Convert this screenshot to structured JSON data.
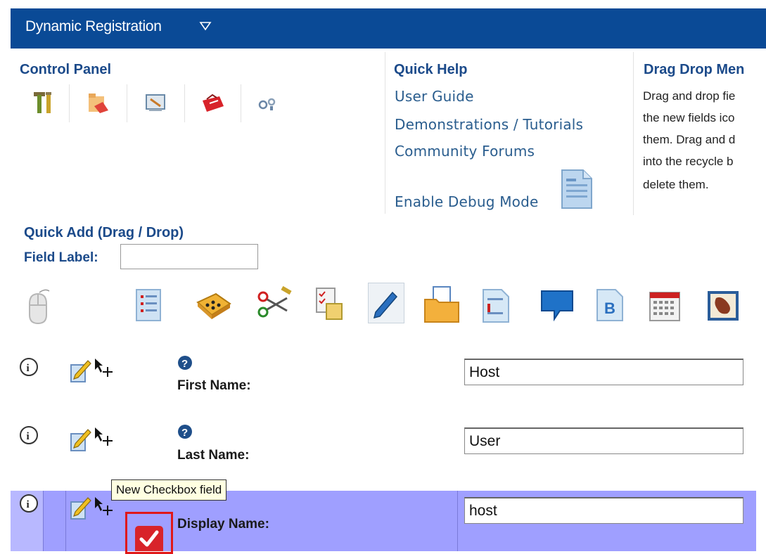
{
  "header": {
    "title": "Dynamic Registration"
  },
  "control_panel": {
    "title": "Control Panel",
    "icons": [
      "tools-icon",
      "folder-edit-icon",
      "screen-edit-icon",
      "toolbox-icon",
      "gears-icon"
    ]
  },
  "quick_help": {
    "title": "Quick Help",
    "links": [
      "User Guide",
      "Demonstrations / Tutorials",
      "Community Forums"
    ],
    "debug_label": "Enable Debug Mode"
  },
  "drag_drop": {
    "title": "Drag Drop Men",
    "lines": [
      "Drag and drop fie",
      "the new fields ico",
      "them. Drag and d",
      "into the recycle b",
      "delete them."
    ]
  },
  "quick_add": {
    "title": "Quick Add (Drag / Drop)",
    "field_label": "Field Label:",
    "field_value": ""
  },
  "field_toolbar": [
    "mouse-icon",
    "list-document-icon",
    "dice-icon",
    "scissors-icon",
    "checklist-icon",
    "pencil-icon",
    "folder-icon",
    "document-icon",
    "speech-bubble-icon",
    "bold-b-icon",
    "calendar-icon",
    "image-icon"
  ],
  "fields": [
    {
      "label": "First Name:",
      "value": "Host",
      "highlighted": false
    },
    {
      "label": "Last Name:",
      "value": "User",
      "highlighted": false
    },
    {
      "label": "Display Name:",
      "value": "host",
      "highlighted": true
    }
  ],
  "tooltip": {
    "text": "New Checkbox field"
  },
  "colors": {
    "header_bg": "#0a4a96",
    "highlight_row": "#9f9fff",
    "accent": "#1b4a8a",
    "checkbox_red": "#d8232a"
  }
}
